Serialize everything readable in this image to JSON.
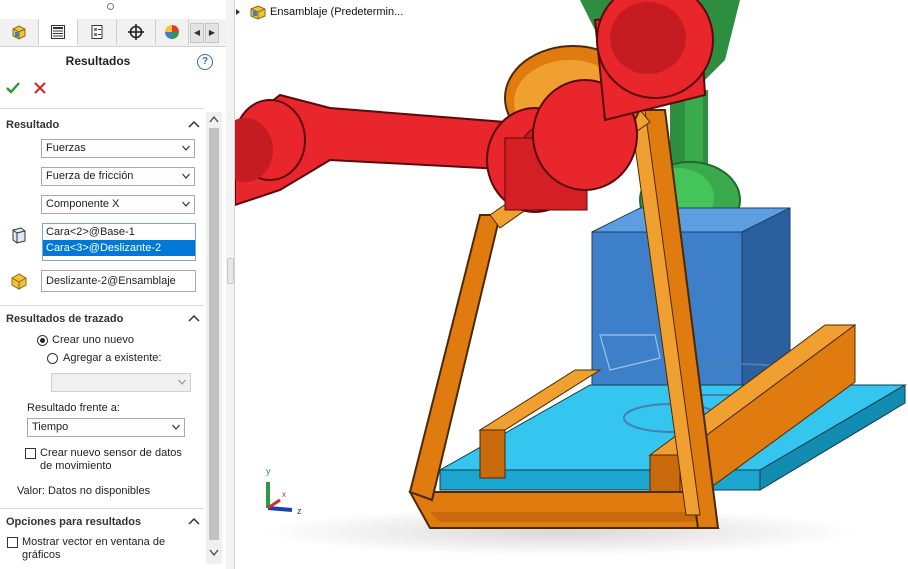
{
  "property_manager": {
    "title": "Resultados",
    "help_icon": "?",
    "ok_icon": "checkmark-icon",
    "cancel_icon": "close-icon"
  },
  "tabs": [
    {
      "name": "featuremanager-tab",
      "icon": "assembly-tree-icon"
    },
    {
      "name": "propertymanager-tab",
      "icon": "property-list-icon"
    },
    {
      "name": "configurationmanager-tab",
      "icon": "configuration-icon"
    },
    {
      "name": "dimxpert-tab",
      "icon": "crosshair-icon"
    },
    {
      "name": "appearances-tab",
      "icon": "color-wheel-icon"
    }
  ],
  "resultado": {
    "title": "Resultado",
    "select1": "Fuerzas",
    "select2": "Fuerza de fricción",
    "select3": "Componente X",
    "faces": [
      "Cara<2>@Base-1",
      "Cara<3>@Deslizante-2"
    ],
    "component": "Deslizante-2@Ensamblaje"
  },
  "trazado": {
    "title": "Resultados de trazado",
    "radio_new": "Crear uno nuevo",
    "radio_add": "Agregar a existente:",
    "existing_value": "",
    "versus_label": "Resultado frente a:",
    "versus_value": "Tiempo",
    "sensor_label_1": "Crear nuevo sensor de datos",
    "sensor_label_2": "de movimiento",
    "valor": "Valor: Datos no disponibles"
  },
  "opciones": {
    "title": "Opciones para resultados",
    "vector_label_1": "Mostrar vector en ventana de",
    "vector_label_2": "gráficos"
  },
  "viewport": {
    "tree_label": "Ensamblaje  (Predetermin...",
    "triad": {
      "x": "x",
      "y": "y",
      "z": "z"
    }
  },
  "colors": {
    "red_link": "#e8262b",
    "orange_frame": "#e07b10",
    "blue_block": "#3d7fc9",
    "cyan_base": "#35c6ef",
    "green_arm": "#2e9a45",
    "selection": "#0078d7"
  }
}
